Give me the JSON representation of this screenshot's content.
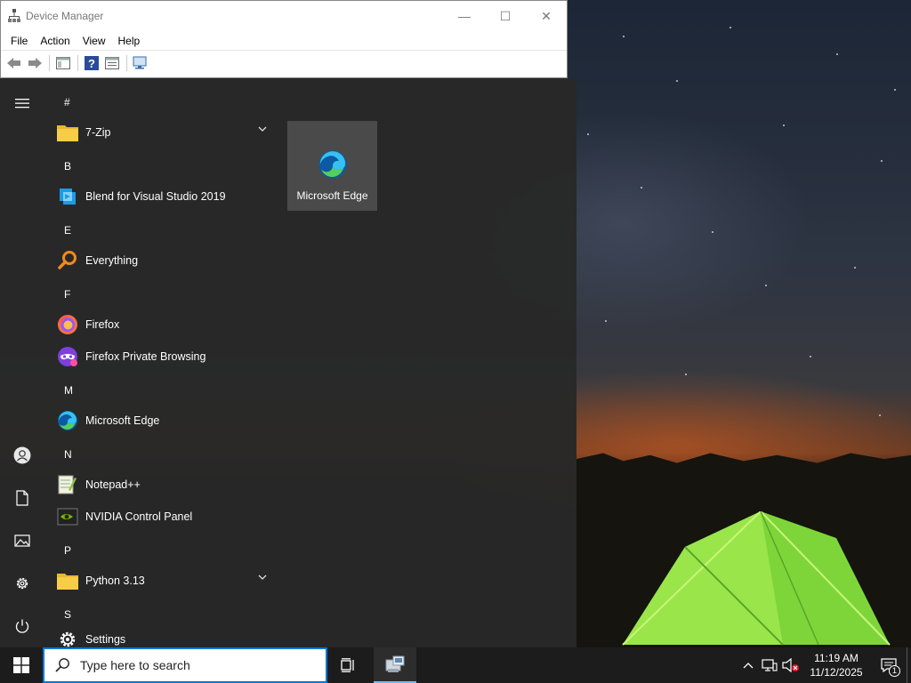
{
  "device_manager": {
    "title": "Device Manager",
    "menu": [
      "File",
      "Action",
      "View",
      "Help"
    ]
  },
  "start_menu": {
    "groups": [
      {
        "letter": "#",
        "apps": [
          {
            "label": "7-Zip",
            "icon": "folder-icon",
            "expandable": true
          }
        ]
      },
      {
        "letter": "B",
        "apps": [
          {
            "label": "Blend for Visual Studio 2019",
            "icon": "blend-icon"
          }
        ]
      },
      {
        "letter": "E",
        "apps": [
          {
            "label": "Everything",
            "icon": "everything-search-icon"
          }
        ]
      },
      {
        "letter": "F",
        "apps": [
          {
            "label": "Firefox",
            "icon": "firefox-icon"
          },
          {
            "label": "Firefox Private Browsing",
            "icon": "firefox-private-icon"
          }
        ]
      },
      {
        "letter": "M",
        "apps": [
          {
            "label": "Microsoft Edge",
            "icon": "edge-icon"
          }
        ]
      },
      {
        "letter": "N",
        "apps": [
          {
            "label": "Notepad++",
            "icon": "notepadpp-icon"
          },
          {
            "label": "NVIDIA Control Panel",
            "icon": "nvidia-icon"
          }
        ]
      },
      {
        "letter": "P",
        "apps": [
          {
            "label": "Python 3.13",
            "icon": "folder-icon",
            "expandable": true
          }
        ]
      },
      {
        "letter": "S",
        "apps": [
          {
            "label": "Settings",
            "icon": "gear-icon"
          }
        ]
      }
    ],
    "tile": {
      "label": "Microsoft Edge",
      "icon": "edge-icon"
    }
  },
  "taskbar": {
    "search_placeholder": "Type here to search",
    "time": "11:19 AM",
    "date": "11/12/2025",
    "notification_count": "1"
  },
  "colors": {
    "accent": "#0078d7",
    "start_bg": "#282828",
    "taskbar_bg": "#1c1c1c",
    "tile_bg": "#4a4a4a"
  }
}
